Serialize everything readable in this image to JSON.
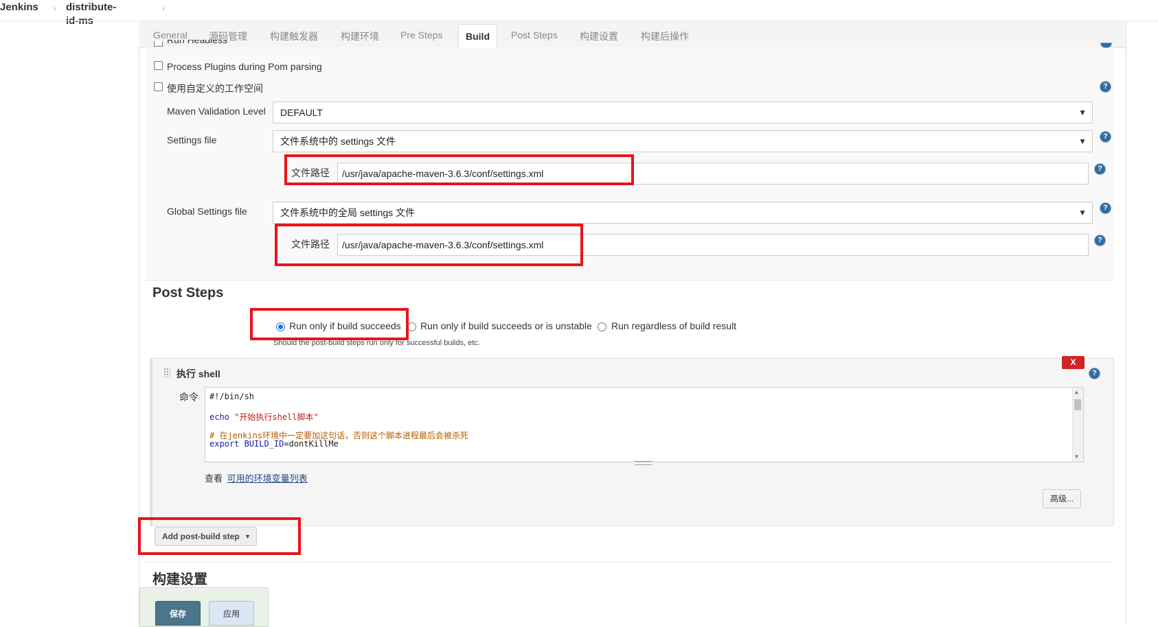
{
  "breadcrumb": {
    "root": "Jenkins",
    "job": "distribute-id-ms"
  },
  "tabs": [
    "General",
    "源码管理",
    "构建触发器",
    "构建环境",
    "Pre Steps",
    "Build",
    "Post Steps",
    "构建设置",
    "构建后操作"
  ],
  "build": {
    "cut_checkbox_label": "Run Headless",
    "process_plugins_label": "Process Plugins during Pom parsing",
    "custom_workspace_label": "使用自定义的工作空间",
    "maven_validation_label": "Maven Validation Level",
    "maven_validation_value": "DEFAULT",
    "settings_file_label": "Settings file",
    "settings_file_value": "文件系统中的 settings 文件",
    "settings_path_label": "文件路径",
    "settings_path_value": "/usr/java/apache-maven-3.6.3/conf/settings.xml",
    "global_settings_label": "Global Settings file",
    "global_settings_value": "文件系统中的全局 settings 文件",
    "global_path_label": "文件路径",
    "global_path_value": "/usr/java/apache-maven-3.6.3/conf/settings.xml"
  },
  "post_steps": {
    "title": "Post Steps",
    "radio_success": "Run only if build succeeds",
    "radio_unstable": "Run only if build succeeds or is unstable",
    "radio_always": "Run regardless of build result",
    "selected": "Run only if build succeeds",
    "hint": "Should the post-build steps run only for successful builds, etc.",
    "shell_title": "执行 shell",
    "command_label": "命令",
    "script_lines": [
      "#!/bin/sh",
      "echo \"开始执行shell脚本\"",
      "# 在jenkins环境中一定要加这句话，否则这个脚本进程最后会被杀死",
      "export BUILD_ID=dontKillMe"
    ],
    "env_prefix": "查看",
    "env_link": "可用的环境变量列表",
    "advanced_button": "高级...",
    "delete_button": "X",
    "add_step_button": "Add post-build step"
  },
  "build_settings_title": "构建设置",
  "footer": {
    "save": "保存",
    "apply": "应用"
  },
  "colors": {
    "highlight_red": "#e8151b",
    "save_blue": "#4b758b",
    "apply_bg": "#dbe7f3"
  }
}
